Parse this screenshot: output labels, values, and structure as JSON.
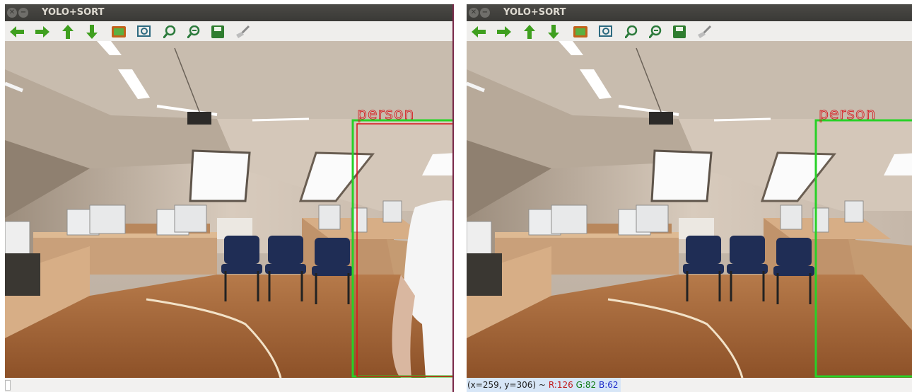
{
  "windows": [
    {
      "title": "YOLO+SORT",
      "detection_label": "person",
      "status": null
    },
    {
      "title": "YOLO+SORT",
      "detection_label": "person",
      "status": {
        "coords": "(x=259, y=306) ~",
        "r": "R:126",
        "g": "G:82",
        "b": "B:62"
      }
    }
  ],
  "toolbar_icons": [
    "arrow-left-icon",
    "arrow-right-icon",
    "arrow-up-icon",
    "arrow-down-icon",
    "image-icon",
    "zoom-fit-icon",
    "zoom-in-icon",
    "zoom-out-icon",
    "save-icon",
    "brush-icon"
  ],
  "colors": {
    "box_green": "#27d127",
    "box_red": "#d8131a",
    "titlebar": "#3e3d39",
    "icon_green": "#3f9f1f"
  }
}
